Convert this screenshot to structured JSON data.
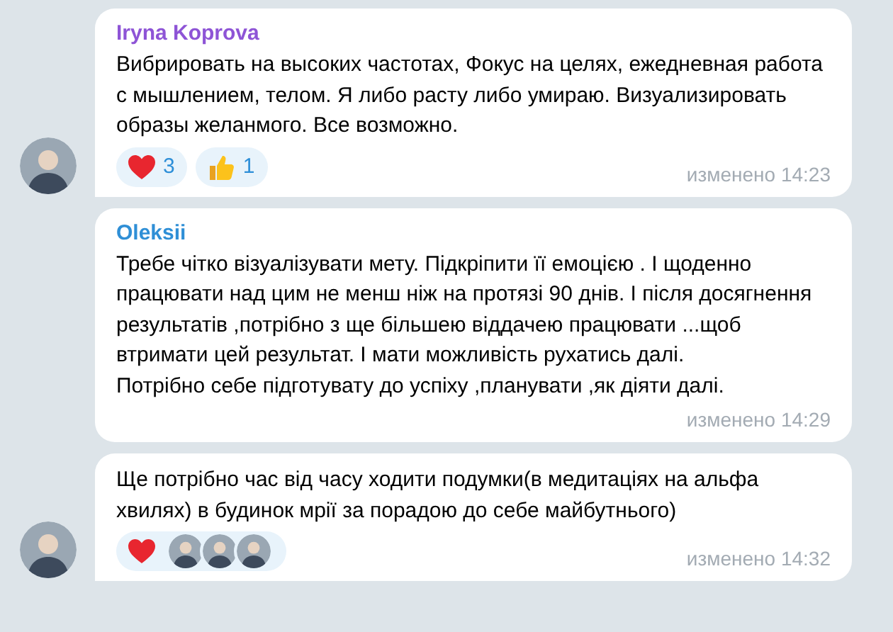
{
  "messages": [
    {
      "author": "Iryna Koprova",
      "color": "#8e54d6",
      "text": "Вибрировать на высоких частотах, Фокус на целях, ежедневная работа с мышлением, телом. Я либо расту либо умираю. Визуализировать образы желанмого. Все возможно.",
      "reactions": [
        {
          "kind": "heart",
          "count": "3"
        },
        {
          "kind": "thumbs-up",
          "count": "1"
        }
      ],
      "time": "изменено 14:23",
      "avatar": {
        "kind": "picture"
      }
    },
    {
      "author": "Oleksii",
      "color": "#2f8fd6",
      "text": "Требе чітко візуалізувати мету. Підкріпити її емоцією . І щоденно працювати над цим не менш ніж на протязі 90 днів. І після досягнення результатів ,потрібно з ще більшею віддачею працювати ...щоб втримати цей результат. І  мати можливість рухатись далі.\nПотрібно себе підготувату до успіху ,планувати ,як діяти далі.",
      "time": "изменено 14:29"
    },
    {
      "text": "Ще потрібно час від часу ходити подумки(в медитаціях на альфа хвилях) в будинок мрії за порадою до себе майбутнього)",
      "reactions": [
        {
          "kind": "heart",
          "reactors": [
            {
              "kind": "picture"
            },
            {
              "kind": "picture"
            },
            {
              "kind": "picture"
            }
          ]
        }
      ],
      "time": "изменено 14:32",
      "avatar": {
        "kind": "picture"
      }
    }
  ]
}
